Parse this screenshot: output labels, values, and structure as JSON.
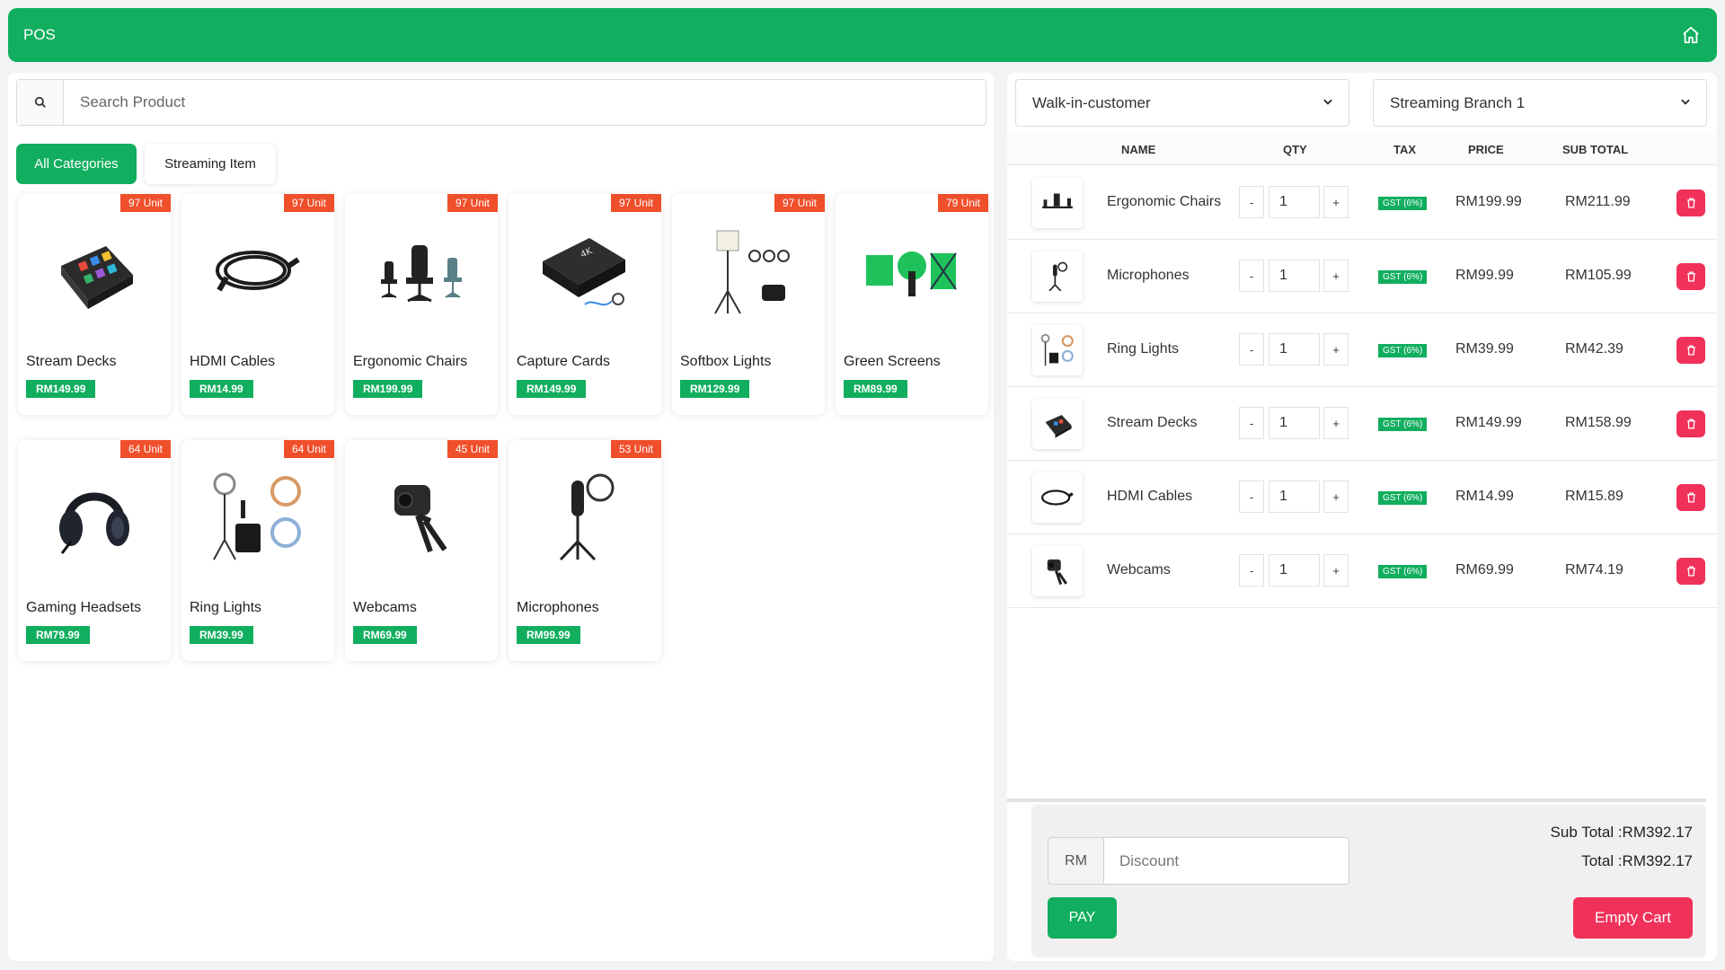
{
  "topbar": {
    "title": "POS",
    "home_icon": "home-icon"
  },
  "search": {
    "placeholder": "Search Product",
    "icon": "search-icon"
  },
  "categories": [
    {
      "label": "All Categories",
      "active": true
    },
    {
      "label": "Streaming Item",
      "active": false
    }
  ],
  "products": [
    {
      "name": "Stream Decks",
      "price": "RM149.99",
      "stock": "97 Unit",
      "icon": "stream-deck-image"
    },
    {
      "name": "HDMI Cables",
      "price": "RM14.99",
      "stock": "97 Unit",
      "icon": "hdmi-cable-image"
    },
    {
      "name": "Ergonomic Chairs",
      "price": "RM199.99",
      "stock": "97 Unit",
      "icon": "chair-image"
    },
    {
      "name": "Capture Cards",
      "price": "RM149.99",
      "stock": "97 Unit",
      "icon": "capture-card-image"
    },
    {
      "name": "Softbox Lights",
      "price": "RM129.99",
      "stock": "97 Unit",
      "icon": "softbox-image"
    },
    {
      "name": "Green Screens",
      "price": "RM89.99",
      "stock": "79 Unit",
      "icon": "green-screen-image"
    },
    {
      "name": "Gaming Headsets",
      "price": "RM79.99",
      "stock": "64 Unit",
      "icon": "headset-image"
    },
    {
      "name": "Ring Lights",
      "price": "RM39.99",
      "stock": "64 Unit",
      "icon": "ring-light-image"
    },
    {
      "name": "Webcams",
      "price": "RM69.99",
      "stock": "45 Unit",
      "icon": "webcam-image"
    },
    {
      "name": "Microphones",
      "price": "RM99.99",
      "stock": "53 Unit",
      "icon": "microphone-image"
    }
  ],
  "customer_select": {
    "value": "Walk-in-customer"
  },
  "branch_select": {
    "value": "Streaming Branch 1"
  },
  "cart": {
    "headers": {
      "name": "NAME",
      "qty": "QTY",
      "tax": "TAX",
      "price": "PRICE",
      "subtotal": "SUB TOTAL"
    },
    "minus": "-",
    "plus": "+",
    "items": [
      {
        "name": "Ergonomic Chairs",
        "qty": "1",
        "tax": "GST (6%)",
        "price": "RM199.99",
        "subtotal": "RM211.99",
        "icon": "chair-image"
      },
      {
        "name": "Microphones",
        "qty": "1",
        "tax": "GST (6%)",
        "price": "RM99.99",
        "subtotal": "RM105.99",
        "icon": "microphone-image"
      },
      {
        "name": "Ring Lights",
        "qty": "1",
        "tax": "GST (6%)",
        "price": "RM39.99",
        "subtotal": "RM42.39",
        "icon": "ring-light-image"
      },
      {
        "name": "Stream Decks",
        "qty": "1",
        "tax": "GST (6%)",
        "price": "RM149.99",
        "subtotal": "RM158.99",
        "icon": "stream-deck-image"
      },
      {
        "name": "HDMI Cables",
        "qty": "1",
        "tax": "GST (6%)",
        "price": "RM14.99",
        "subtotal": "RM15.89",
        "icon": "hdmi-cable-image"
      },
      {
        "name": "Webcams",
        "qty": "1",
        "tax": "GST (6%)",
        "price": "RM69.99",
        "subtotal": "RM74.19",
        "icon": "webcam-image"
      }
    ]
  },
  "summary": {
    "currency_label": "RM",
    "discount_placeholder": "Discount",
    "subtotal": "Sub Total :RM392.17",
    "total": "Total :RM392.17",
    "pay_label": "PAY",
    "empty_label": "Empty Cart"
  },
  "colors": {
    "brand": "#10ae5e",
    "stock_badge": "#f04f2b",
    "danger": "#f0315a"
  }
}
